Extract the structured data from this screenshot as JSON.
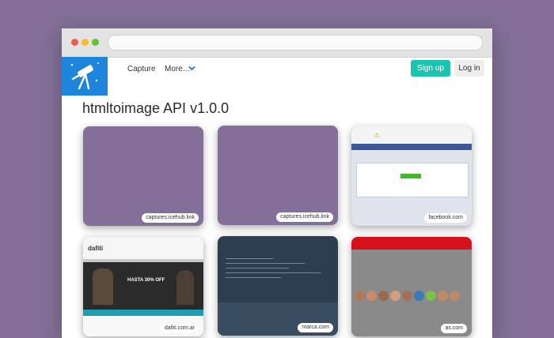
{
  "nav": {
    "capture": "Capture",
    "more": "More…",
    "signup": "Sign up",
    "login": "Log in"
  },
  "title": "htmltoimage API v1.0.0",
  "cards": [
    {
      "label": "captures.icehub.link",
      "variant": "plain"
    },
    {
      "label": "captures.icehub.link",
      "variant": "plain"
    },
    {
      "label": "facebook.com",
      "variant": "facebook"
    },
    {
      "label": "dafiti.com.ar",
      "variant": "dafiti"
    },
    {
      "label": "marca.com",
      "variant": "dark"
    },
    {
      "label": "as.com",
      "variant": "as"
    }
  ],
  "dafiti": {
    "brand": "dafiti",
    "headline": "HASTA 30% OFF"
  },
  "colors": {
    "background": "#836f97",
    "accent_teal": "#1bc3b1",
    "logo_blue": "#1d86dc"
  }
}
